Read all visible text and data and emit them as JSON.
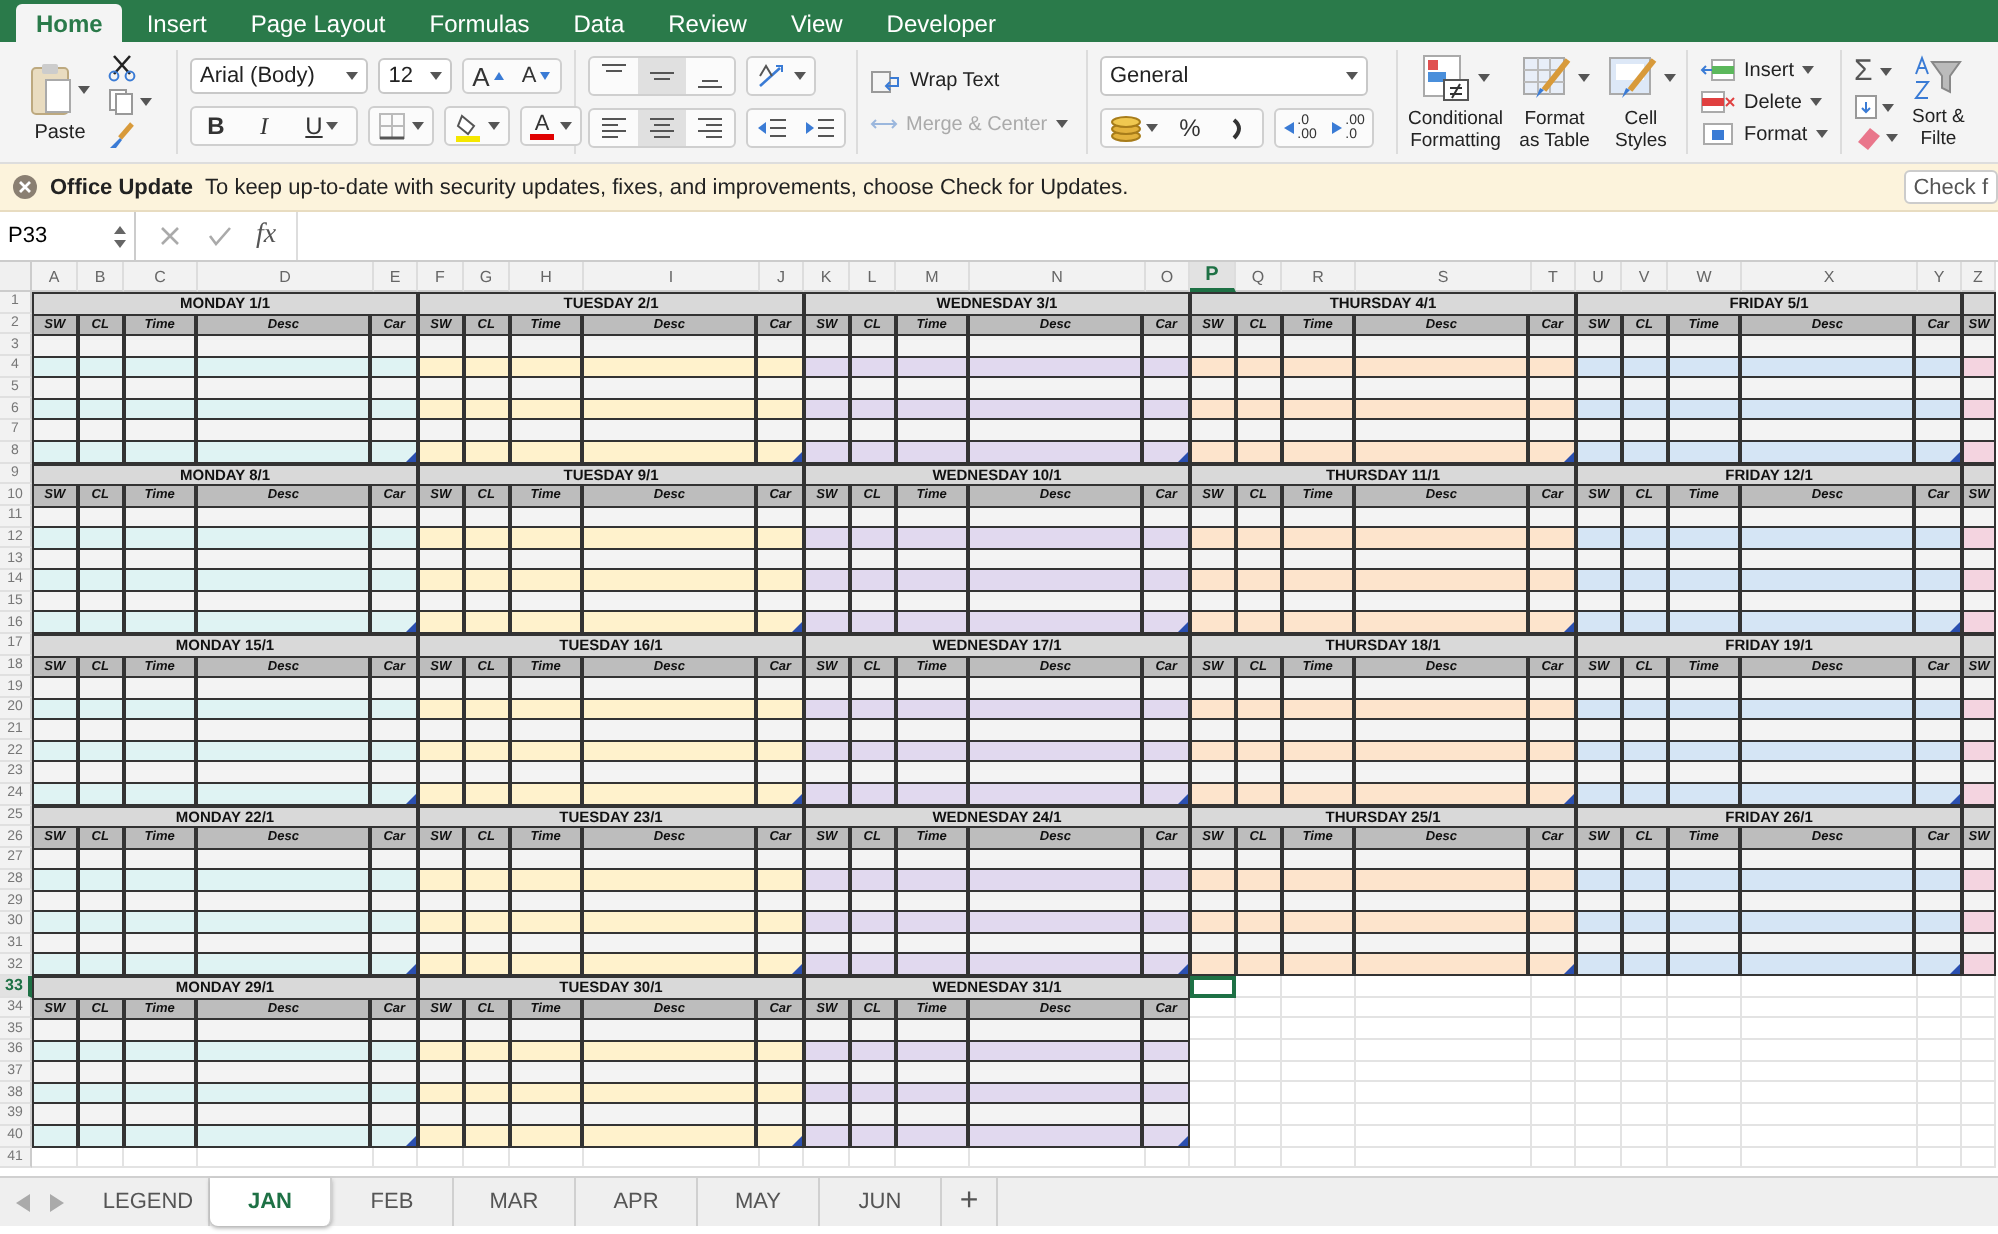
{
  "menu_tabs": [
    {
      "label": "Home",
      "selected": true
    },
    {
      "label": "Insert",
      "selected": false
    },
    {
      "label": "Page Layout",
      "selected": false
    },
    {
      "label": "Formulas",
      "selected": false
    },
    {
      "label": "Data",
      "selected": false
    },
    {
      "label": "Review",
      "selected": false
    },
    {
      "label": "View",
      "selected": false
    },
    {
      "label": "Developer",
      "selected": false
    }
  ],
  "ribbon": {
    "paste": "Paste",
    "font": {
      "family": "Arial (Body)",
      "size": "12",
      "grow": "A",
      "shrink": "A",
      "bold": "B",
      "italic": "I",
      "underline": "U",
      "font_color": "A"
    },
    "vertical_align": [
      {
        "selected": false
      },
      {
        "selected": true
      },
      {
        "selected": false
      }
    ],
    "horizontal_align": [
      {
        "selected": false
      },
      {
        "selected": true
      },
      {
        "selected": false
      }
    ],
    "wrap_text": "Wrap Text",
    "merge_center": {
      "label": "Merge & Center",
      "disabled": true
    },
    "number_format": "General",
    "percent": "%",
    "increase_decimal": [
      ".0",
      ".00"
    ],
    "decrease_decimal": [
      ".00",
      ".0"
    ],
    "styles": [
      {
        "kind": "conditional",
        "lines": [
          "Conditional",
          "Formatting"
        ]
      },
      {
        "kind": "table",
        "lines": [
          "Format",
          "as Table"
        ]
      },
      {
        "kind": "cell",
        "lines": [
          "Cell",
          "Styles"
        ]
      }
    ],
    "cells": [
      {
        "kind": "insert",
        "label": "Insert"
      },
      {
        "kind": "delete",
        "label": "Delete"
      },
      {
        "kind": "format",
        "label": "Format"
      }
    ],
    "autosum": "Σ",
    "sort_filter": [
      "Sort &",
      "Filte"
    ]
  },
  "update_bar": {
    "title": "Office Update",
    "message": "To keep up-to-date with security updates, fixes, and improvements, choose Check for Updates.",
    "button": "Check f"
  },
  "formula_bar": {
    "name_box": "P33",
    "fx": "fx"
  },
  "columns": [
    {
      "label": "A",
      "selected": false
    },
    {
      "label": "B",
      "selected": false
    },
    {
      "label": "C",
      "selected": false
    },
    {
      "label": "D",
      "selected": false
    },
    {
      "label": "E",
      "selected": false
    },
    {
      "label": "F",
      "selected": false
    },
    {
      "label": "G",
      "selected": false
    },
    {
      "label": "H",
      "selected": false
    },
    {
      "label": "I",
      "selected": false
    },
    {
      "label": "J",
      "selected": false
    },
    {
      "label": "K",
      "selected": false
    },
    {
      "label": "L",
      "selected": false
    },
    {
      "label": "M",
      "selected": false
    },
    {
      "label": "N",
      "selected": false
    },
    {
      "label": "O",
      "selected": false
    },
    {
      "label": "P",
      "selected": true
    },
    {
      "label": "Q",
      "selected": false
    },
    {
      "label": "R",
      "selected": false
    },
    {
      "label": "S",
      "selected": false
    },
    {
      "label": "T",
      "selected": false
    },
    {
      "label": "U",
      "selected": false
    },
    {
      "label": "V",
      "selected": false
    },
    {
      "label": "W",
      "selected": false
    },
    {
      "label": "X",
      "selected": false
    },
    {
      "label": "Y",
      "selected": false
    },
    {
      "label": "Z",
      "selected": false
    }
  ],
  "row_numbers": [
    {
      "label": "1",
      "selected": false
    },
    {
      "label": "2",
      "selected": false
    },
    {
      "label": "3",
      "selected": false
    },
    {
      "label": "4",
      "selected": false
    },
    {
      "label": "5",
      "selected": false
    },
    {
      "label": "6",
      "selected": false
    },
    {
      "label": "7",
      "selected": false
    },
    {
      "label": "8",
      "selected": false
    },
    {
      "label": "9",
      "selected": false
    },
    {
      "label": "10",
      "selected": false
    },
    {
      "label": "11",
      "selected": false
    },
    {
      "label": "12",
      "selected": false
    },
    {
      "label": "13",
      "selected": false
    },
    {
      "label": "14",
      "selected": false
    },
    {
      "label": "15",
      "selected": false
    },
    {
      "label": "16",
      "selected": false
    },
    {
      "label": "17",
      "selected": false
    },
    {
      "label": "18",
      "selected": false
    },
    {
      "label": "19",
      "selected": false
    },
    {
      "label": "20",
      "selected": false
    },
    {
      "label": "21",
      "selected": false
    },
    {
      "label": "22",
      "selected": false
    },
    {
      "label": "23",
      "selected": false
    },
    {
      "label": "24",
      "selected": false
    },
    {
      "label": "25",
      "selected": false
    },
    {
      "label": "26",
      "selected": false
    },
    {
      "label": "27",
      "selected": false
    },
    {
      "label": "28",
      "selected": false
    },
    {
      "label": "29",
      "selected": false
    },
    {
      "label": "30",
      "selected": false
    },
    {
      "label": "31",
      "selected": false
    },
    {
      "label": "32",
      "selected": false
    },
    {
      "label": "33",
      "selected": true
    },
    {
      "label": "34",
      "selected": false
    },
    {
      "label": "35",
      "selected": false
    },
    {
      "label": "36",
      "selected": false
    },
    {
      "label": "37",
      "selected": false
    },
    {
      "label": "38",
      "selected": false
    },
    {
      "label": "39",
      "selected": false
    },
    {
      "label": "40",
      "selected": false
    },
    {
      "label": "41",
      "selected": false
    }
  ],
  "weeks": [
    {
      "days": [
        {
          "title": "MONDAY 1/1",
          "color": "#dff3f3",
          "columns": [
            "SW",
            "CL",
            "Time",
            "Desc",
            "Car"
          ]
        },
        {
          "title": "TUESDAY 2/1",
          "color": "#fff2cc",
          "columns": [
            "SW",
            "CL",
            "Time",
            "Desc",
            "Car"
          ]
        },
        {
          "title": "WEDNESDAY 3/1",
          "color": "#e1d9ef",
          "columns": [
            "SW",
            "CL",
            "Time",
            "Desc",
            "Car"
          ]
        },
        {
          "title": "THURSDAY 4/1",
          "color": "#fde4cc",
          "columns": [
            "SW",
            "CL",
            "Time",
            "Desc",
            "Car"
          ]
        },
        {
          "title": "FRIDAY 5/1",
          "color": "#d5e5f5",
          "columns": [
            "SW",
            "CL",
            "Time",
            "Desc",
            "Car"
          ]
        },
        {
          "color": "#f4d4e0",
          "columns": [
            "SW"
          ]
        }
      ]
    },
    {
      "days": [
        {
          "title": "MONDAY 8/1",
          "color": "#dff3f3",
          "columns": [
            "SW",
            "CL",
            "Time",
            "Desc",
            "Car"
          ]
        },
        {
          "title": "TUESDAY 9/1",
          "color": "#fff2cc",
          "columns": [
            "SW",
            "CL",
            "Time",
            "Desc",
            "Car"
          ]
        },
        {
          "title": "WEDNESDAY 10/1",
          "color": "#e1d9ef",
          "columns": [
            "SW",
            "CL",
            "Time",
            "Desc",
            "Car"
          ]
        },
        {
          "title": "THURSDAY 11/1",
          "color": "#fde4cc",
          "columns": [
            "SW",
            "CL",
            "Time",
            "Desc",
            "Car"
          ]
        },
        {
          "title": "FRIDAY 12/1",
          "color": "#d5e5f5",
          "columns": [
            "SW",
            "CL",
            "Time",
            "Desc",
            "Car"
          ]
        },
        {
          "color": "#f4d4e0",
          "columns": [
            "SW"
          ]
        }
      ]
    },
    {
      "days": [
        {
          "title": "MONDAY 15/1",
          "color": "#dff3f3",
          "columns": [
            "SW",
            "CL",
            "Time",
            "Desc",
            "Car"
          ]
        },
        {
          "title": "TUESDAY 16/1",
          "color": "#fff2cc",
          "columns": [
            "SW",
            "CL",
            "Time",
            "Desc",
            "Car"
          ]
        },
        {
          "title": "WEDNESDAY 17/1",
          "color": "#e1d9ef",
          "columns": [
            "SW",
            "CL",
            "Time",
            "Desc",
            "Car"
          ]
        },
        {
          "title": "THURSDAY 18/1",
          "color": "#fde4cc",
          "columns": [
            "SW",
            "CL",
            "Time",
            "Desc",
            "Car"
          ]
        },
        {
          "title": "FRIDAY 19/1",
          "color": "#d5e5f5",
          "columns": [
            "SW",
            "CL",
            "Time",
            "Desc",
            "Car"
          ]
        },
        {
          "color": "#f4d4e0",
          "columns": [
            "SW"
          ]
        }
      ]
    },
    {
      "days": [
        {
          "title": "MONDAY 22/1",
          "color": "#dff3f3",
          "columns": [
            "SW",
            "CL",
            "Time",
            "Desc",
            "Car"
          ]
        },
        {
          "title": "TUESDAY 23/1",
          "color": "#fff2cc",
          "columns": [
            "SW",
            "CL",
            "Time",
            "Desc",
            "Car"
          ]
        },
        {
          "title": "WEDNESDAY 24/1",
          "color": "#e1d9ef",
          "columns": [
            "SW",
            "CL",
            "Time",
            "Desc",
            "Car"
          ]
        },
        {
          "title": "THURSDAY 25/1",
          "color": "#fde4cc",
          "columns": [
            "SW",
            "CL",
            "Time",
            "Desc",
            "Car"
          ]
        },
        {
          "title": "FRIDAY 26/1",
          "color": "#d5e5f5",
          "columns": [
            "SW",
            "CL",
            "Time",
            "Desc",
            "Car"
          ]
        },
        {
          "color": "#f4d4e0",
          "columns": [
            "SW"
          ]
        }
      ]
    },
    {
      "days": [
        {
          "title": "MONDAY 29/1",
          "color": "#dff3f3",
          "columns": [
            "SW",
            "CL",
            "Time",
            "Desc",
            "Car"
          ]
        },
        {
          "title": "TUESDAY 30/1",
          "color": "#fff2cc",
          "columns": [
            "SW",
            "CL",
            "Time",
            "Desc",
            "Car"
          ]
        },
        {
          "title": "WEDNESDAY 31/1",
          "color": "#e1d9ef",
          "columns": [
            "SW",
            "CL",
            "Time",
            "Desc",
            "Car"
          ]
        }
      ]
    }
  ],
  "sheet_tabs": [
    {
      "label": "LEGEND",
      "selected": false
    },
    {
      "label": "JAN",
      "selected": true
    },
    {
      "label": "FEB",
      "selected": false
    },
    {
      "label": "MAR",
      "selected": false
    },
    {
      "label": "APR",
      "selected": false
    },
    {
      "label": "MAY",
      "selected": false
    },
    {
      "label": "JUN",
      "selected": false
    }
  ],
  "add_sheet": "+"
}
